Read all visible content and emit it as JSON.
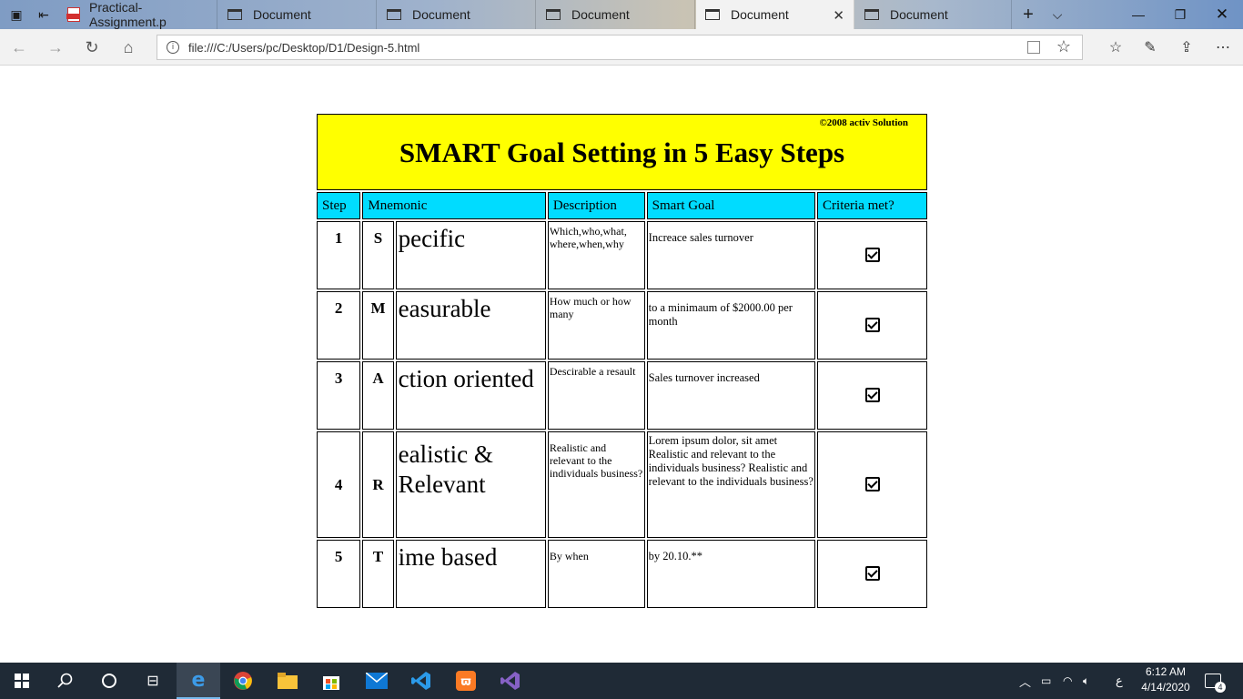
{
  "browser": {
    "tabs": [
      {
        "title": "Practical-Assignment.p",
        "icon": "pdf-icon",
        "active": false
      },
      {
        "title": "Document",
        "icon": "document-icon",
        "active": false
      },
      {
        "title": "Document",
        "icon": "document-icon",
        "active": false
      },
      {
        "title": "Document",
        "icon": "document-icon",
        "active": false
      },
      {
        "title": "Document",
        "icon": "document-icon",
        "active": true
      },
      {
        "title": "Document",
        "icon": "document-icon",
        "active": false
      }
    ],
    "url": "file:///C:/Users/pc/Desktop/D1/Design-5.html"
  },
  "page": {
    "copyright": "©2008 activ Solution",
    "title": "SMART Goal Setting in 5 Easy Steps",
    "headers": [
      "Step",
      "Mnemonic",
      "Description",
      "Smart Goal",
      "Criteria met?"
    ],
    "rows": [
      {
        "step": "1",
        "letter": "S",
        "word": "pecific",
        "description": "Which,who,what, where,when,why",
        "goal": "Increace sales turnover",
        "met": true
      },
      {
        "step": "2",
        "letter": "M",
        "word": "easurable",
        "description": "How much or how many",
        "goal": "to a minimaum of $2000.00 per month",
        "met": true
      },
      {
        "step": "3",
        "letter": "A",
        "word": "ction oriented",
        "description": "Descirable a resault",
        "goal": "Sales turnover increased",
        "met": true
      },
      {
        "step": "4",
        "letter": "R",
        "word": "ealistic & Relevant",
        "description": "Realistic and relevant to the individuals business?",
        "goal": "Lorem ipsum dolor, sit amet Realistic and relevant to the individuals business? Realistic and relevant to the individuals business?",
        "met": true
      },
      {
        "step": "5",
        "letter": "T",
        "word": "ime based",
        "description": "By when",
        "goal": "by 20.10.**",
        "met": true
      }
    ]
  },
  "taskbar": {
    "time": "6:12 AM",
    "date": "4/14/2020",
    "notifications": "4",
    "language": "ع"
  },
  "colors": {
    "header_bg": "#ffff00",
    "column_header_bg": "#00dcff",
    "taskbar_bg": "#1f2a36"
  }
}
